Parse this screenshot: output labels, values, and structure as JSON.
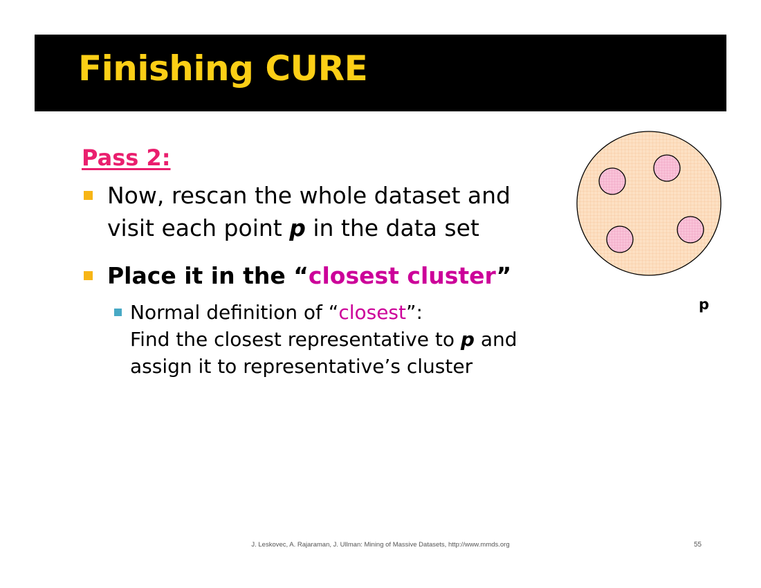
{
  "slide": {
    "title": "Finishing CURE",
    "pass_label": "Pass 2:",
    "bullet1": {
      "text_a": "Now, rescan the whole dataset and",
      "text_b": "visit each point ",
      "text_c": "p",
      "text_d": " in the data set"
    },
    "bullet2": {
      "text_a": "Place it in the “",
      "text_b": "closest cluster",
      "text_c": "”"
    },
    "sub_bullet": {
      "line1_a": "Normal definition of “",
      "line1_b": "closest",
      "line1_c": "”:",
      "line2_a": "Find the closest representative to ",
      "line2_b": "p",
      "line2_c": " and",
      "line3": "assign it to representative’s cluster"
    },
    "diagram_point_label": "p",
    "footer": "J. Leskovec, A. Rajaraman, J. Ullman: Mining of Massive Datasets, http://www.mmds.org",
    "page_number": "55"
  },
  "colors": {
    "title_text": "#fccf16",
    "title_bar": "#000000",
    "pass_label": "#ea1f6e",
    "highlight": "#cc0099",
    "bullet_level1": "#f7b516",
    "bullet_level2": "#48a9c5",
    "cluster_fill": "#fde0c3",
    "representative_fill": "#f9c2d8"
  }
}
